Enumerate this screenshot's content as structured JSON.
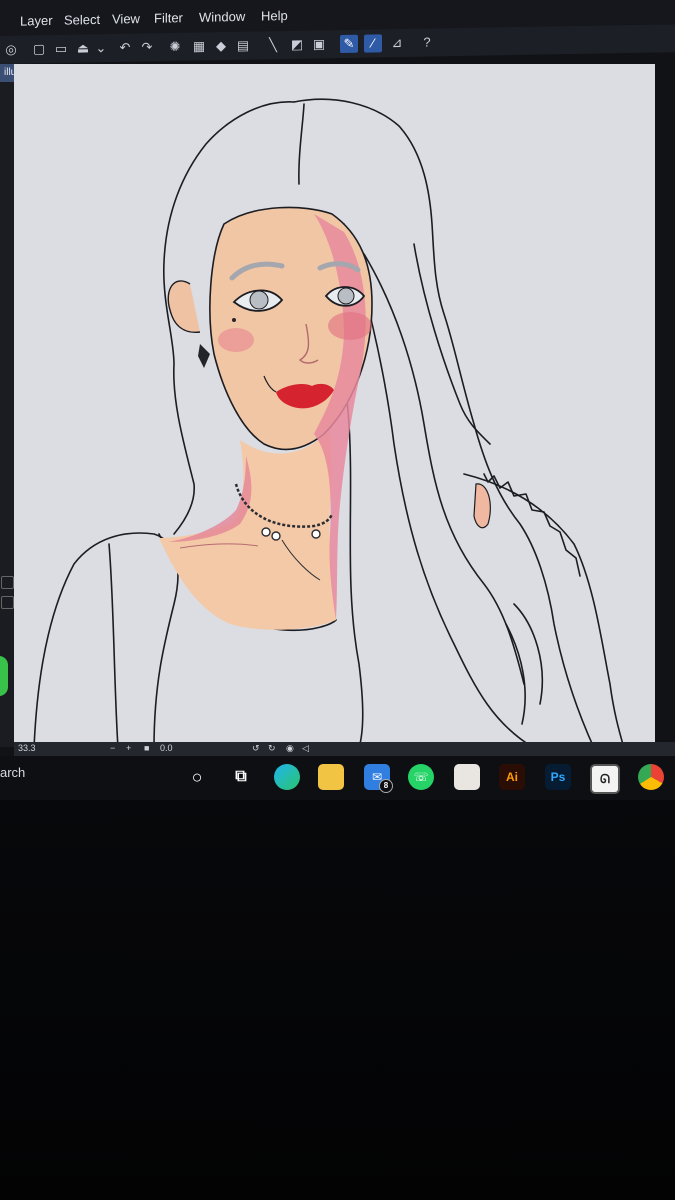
{
  "menu": {
    "layer": "Layer",
    "select": "Select",
    "view": "View",
    "filter": "Filter",
    "window": "Window",
    "help": "Help"
  },
  "document": {
    "tab_title": "illustration*"
  },
  "statusbar": {
    "zoom": "33.3",
    "angle": "0.0"
  },
  "taskbar": {
    "search_label": "arch",
    "mail_badge": "8",
    "apps": [
      "cortana-icon",
      "task-view-icon",
      "edge-icon",
      "file-explorer-icon",
      "mail-icon",
      "whatsapp-icon",
      "microsoft-store-icon",
      "illustrator-icon",
      "photoshop-icon",
      "clip-studio-icon",
      "chrome-icon"
    ],
    "illustrator_label": "Ai",
    "photoshop_label": "Ps"
  },
  "colors": {
    "accent": "#2f5aa6",
    "canvas": "#dbdde2",
    "skin": "#f3c7a8",
    "skin_shadow": "#e98a9d",
    "lips": "#d8242f"
  }
}
